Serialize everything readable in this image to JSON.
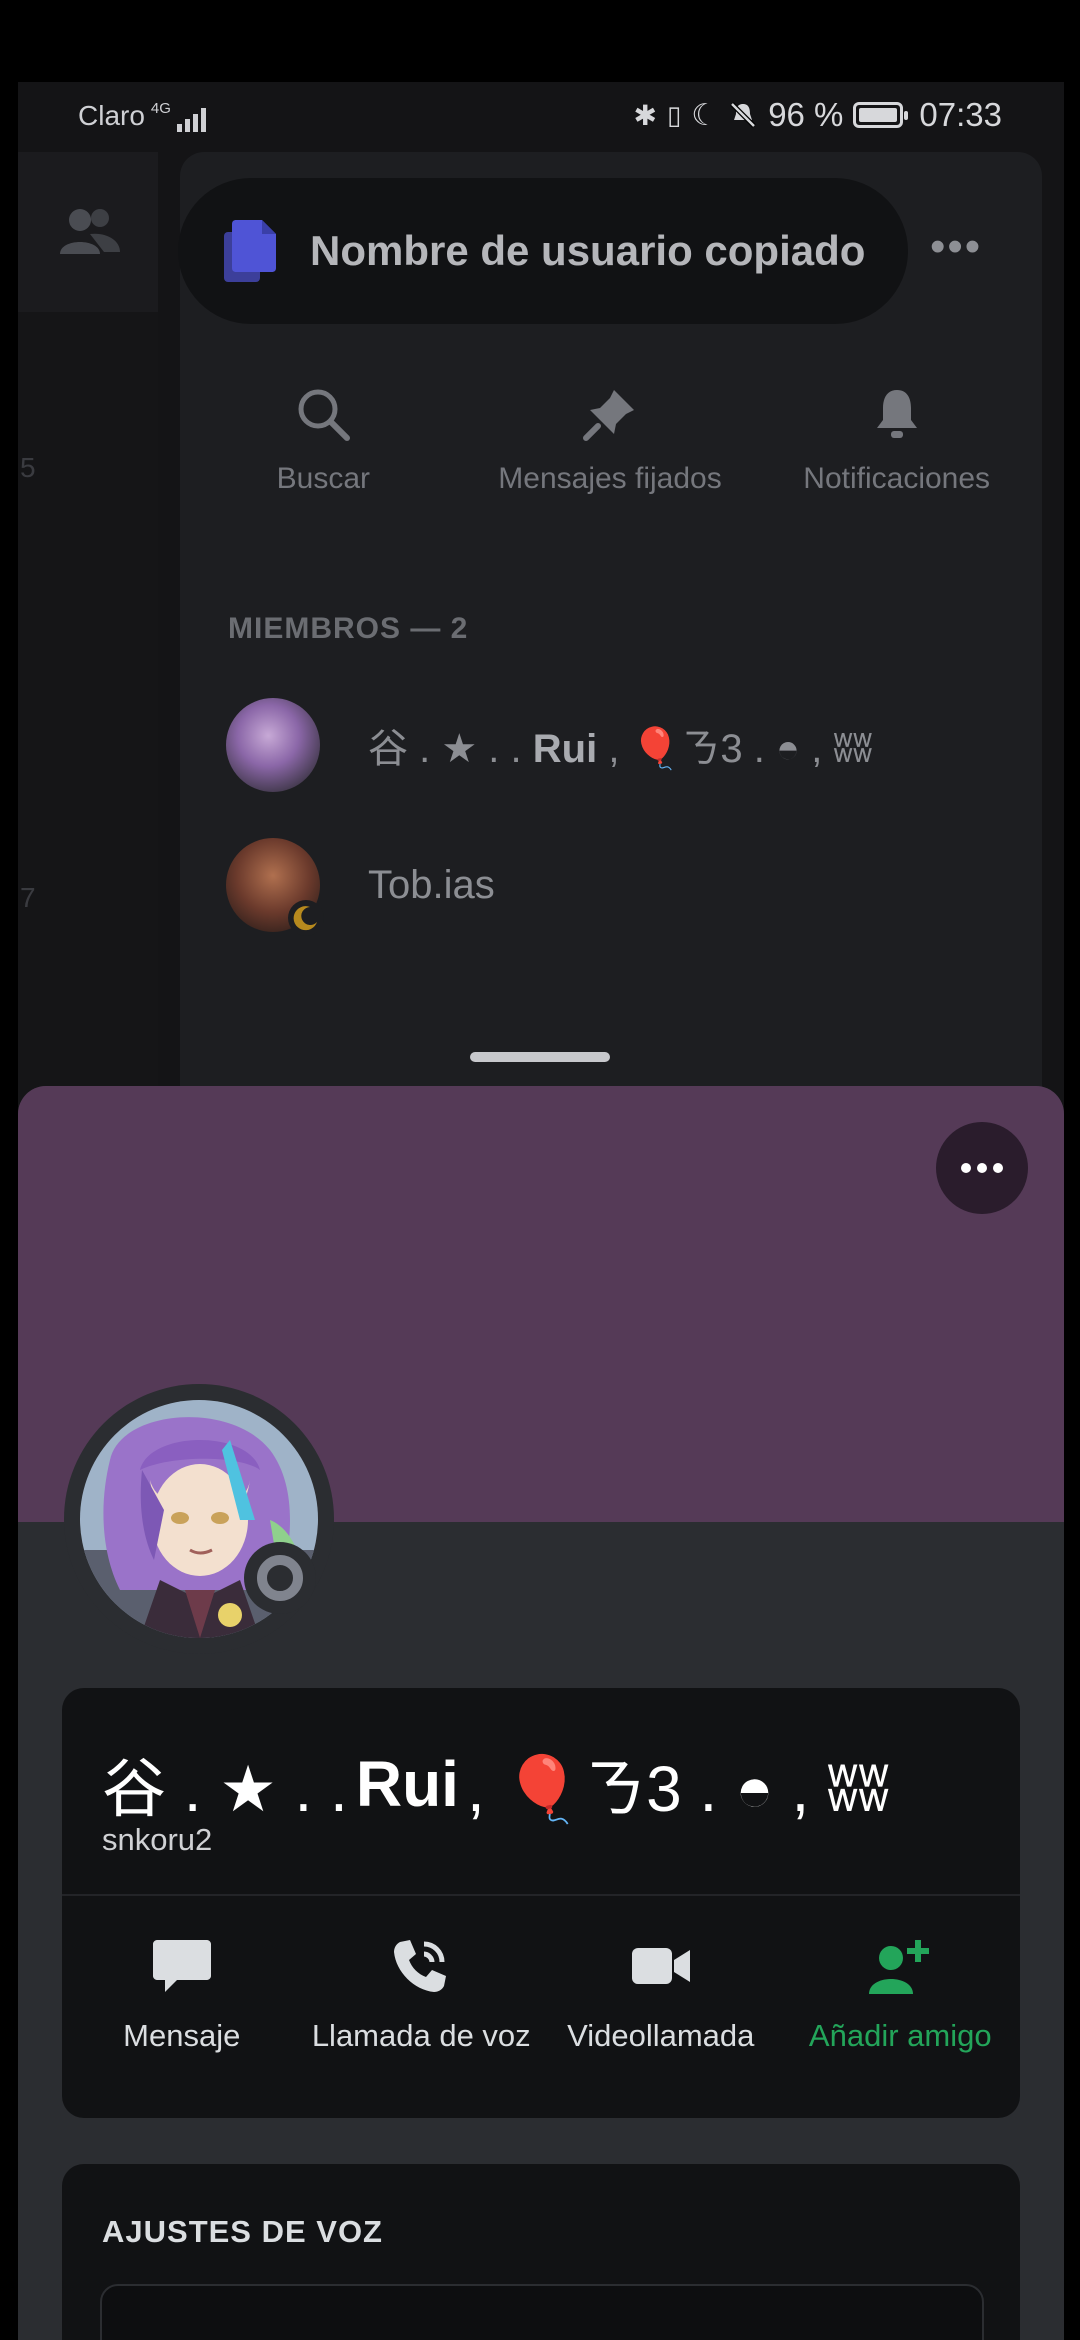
{
  "status_bar": {
    "carrier": "Claro",
    "network": "4G",
    "battery": "96 %",
    "time": "07:33"
  },
  "toast": {
    "icon": "copy-icon",
    "message": "Nombre de usuario copiado"
  },
  "channel_actions": [
    {
      "icon": "search-icon",
      "label": "Buscar"
    },
    {
      "icon": "pin-icon",
      "label": "Mensajes fijados"
    },
    {
      "icon": "bell-icon",
      "label": "Notificaciones"
    }
  ],
  "left_rail": {
    "icon": "friends-icon",
    "numbers": [
      "5",
      "7"
    ]
  },
  "members": {
    "header": "MIEMBROS — 2",
    "list": [
      {
        "name_prefix": "谷 . ★ . . ",
        "name_bold": "Rui",
        "name_suffix": " , 🎈ㄋ3 . ◓ , ʬʬ"
      },
      {
        "name_prefix": "Tob.ias",
        "name_bold": "",
        "name_suffix": ""
      }
    ]
  },
  "profile": {
    "banner_color": "#553a57",
    "display_name_prefix": "谷 . ★ . . ",
    "display_name_bold": "Rui",
    "display_name_suffix": " , 🎈ㄋ3 . ◓ , ʬʬ",
    "username": "snkoru2",
    "status": "offline",
    "actions": [
      {
        "icon": "message-icon",
        "label": "Mensaje"
      },
      {
        "icon": "voice-call-icon",
        "label": "Llamada de voz"
      },
      {
        "icon": "video-call-icon",
        "label": "Videollamada"
      },
      {
        "icon": "add-friend-icon",
        "label": "Añadir amigo",
        "color": "#23a55a"
      }
    ]
  },
  "voice_settings": {
    "title": "AJUSTES DE VOZ"
  }
}
